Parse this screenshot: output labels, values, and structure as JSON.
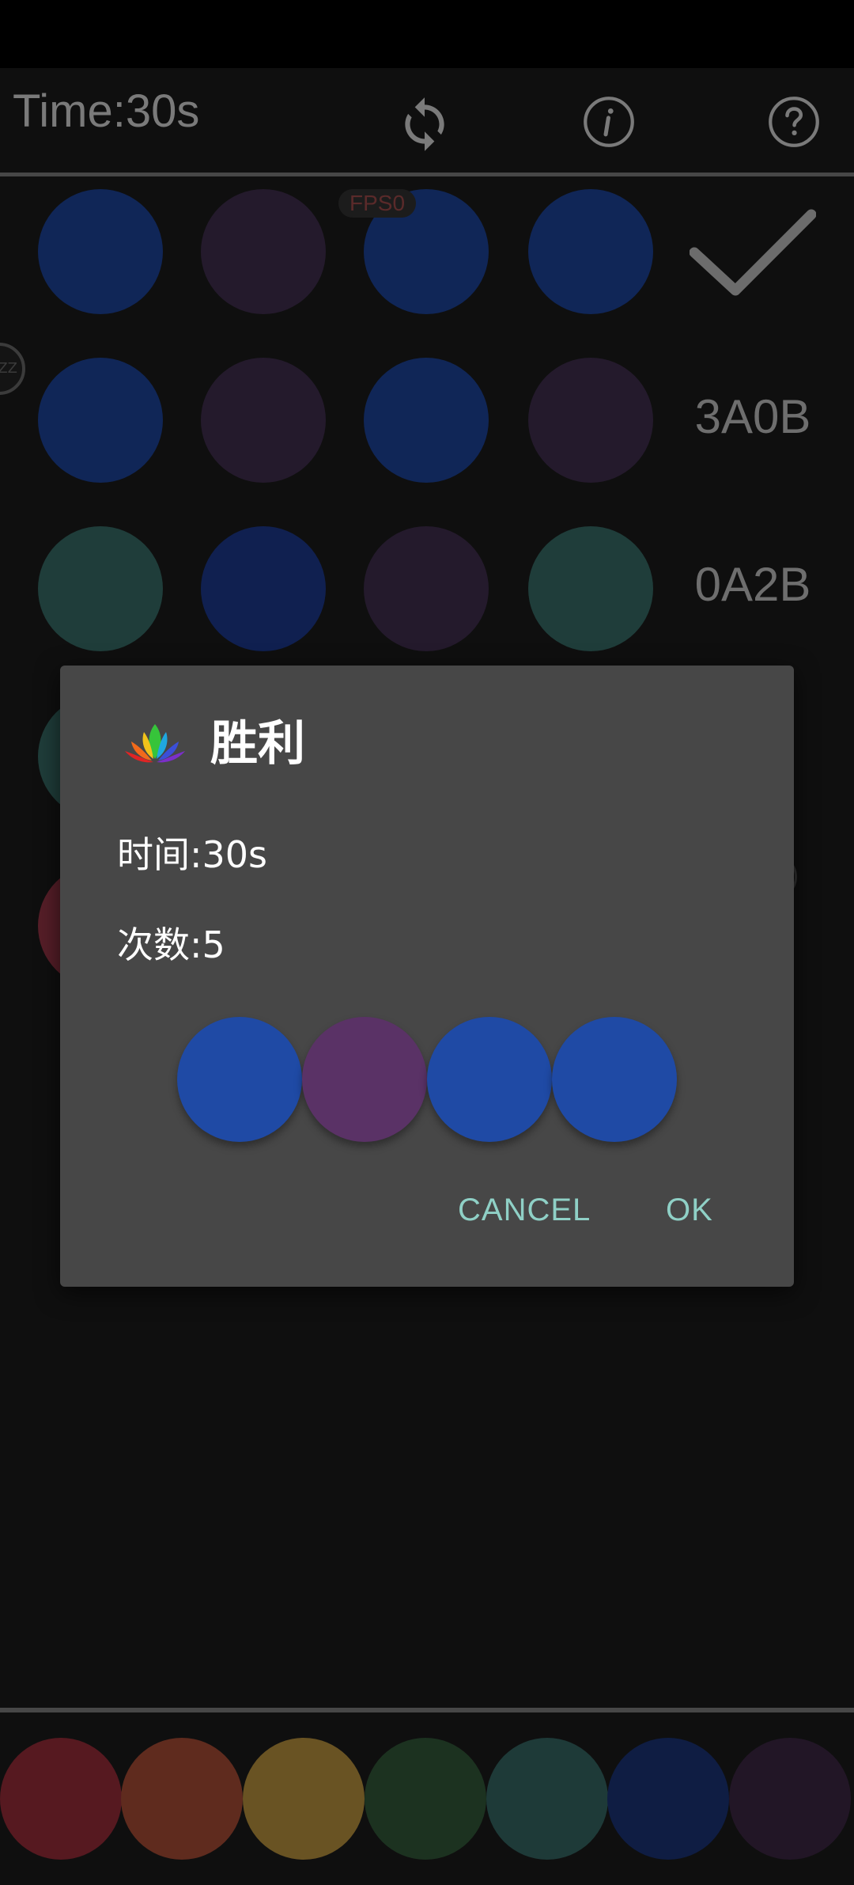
{
  "header": {
    "time_label": "Time:30s",
    "refresh_icon": "refresh-icon",
    "info_icon": "info-icon",
    "help_icon": "help-icon"
  },
  "board": {
    "fps_label": "FPS0",
    "edge_badge_text": "ZZ",
    "rows": [
      {
        "pegs": [
          "#102657",
          "#241a2c",
          "#102657",
          "#102657"
        ],
        "result": "check",
        "result_icon": "checkmark-icon"
      },
      {
        "pegs": [
          "#102657",
          "#241a2c",
          "#102657",
          "#241a2c"
        ],
        "result": "3A0B"
      },
      {
        "pegs": [
          "#1f3d3a",
          "#102050",
          "#241a2c",
          "#1f3d3a"
        ],
        "result": "0A2B"
      },
      {
        "pegs": [
          "#1f3d3a"
        ],
        "partial": true
      },
      {
        "pegs": [
          "#561e28"
        ],
        "partial": true
      }
    ]
  },
  "palette": {
    "colors": [
      "#561920",
      "#5f2b1e",
      "#695323",
      "#1c3220",
      "#1e3a38",
      "#0f1d43",
      "#221626"
    ]
  },
  "dialog": {
    "title": "胜利",
    "icon": "lotus-icon",
    "time_line": "时间:30s",
    "count_line": "次数:5",
    "answer_colors": [
      "#1f4aa5",
      "#5a3266",
      "#1f4aa5",
      "#1f4aa5"
    ],
    "cancel_label": "CANCEL",
    "ok_label": "OK"
  }
}
